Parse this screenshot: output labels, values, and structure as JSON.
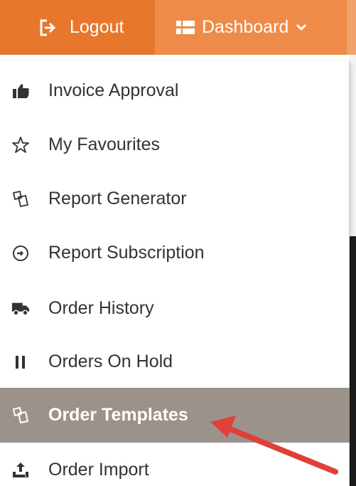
{
  "nav": {
    "logout": {
      "label": "Logout",
      "icon": "logout-icon"
    },
    "dashboard": {
      "label": "Dashboard",
      "icon": "grid-icon",
      "caret_icon": "chevron-down-icon"
    }
  },
  "menu": {
    "items": [
      {
        "label": "Invoice Approval",
        "icon": "thumbs-up-icon"
      },
      {
        "label": "My Favourites",
        "icon": "star-outline-icon"
      },
      {
        "label": "Report Generator",
        "icon": "copy-icon"
      },
      {
        "label": "Report Subscription",
        "icon": "circle-arrow-icon"
      },
      {
        "label": "Order History",
        "icon": "truck-icon"
      },
      {
        "label": "Orders On Hold",
        "icon": "pause-icon"
      },
      {
        "label": "Order Templates",
        "icon": "copy-icon",
        "active": true
      },
      {
        "label": "Order Import",
        "icon": "upload-icon"
      }
    ]
  },
  "colors": {
    "navbar": "#e8772e",
    "navbar_active": "#ee8b48",
    "menu_active_bg": "#9b928c",
    "menu_text": "#333333",
    "annotation_arrow": "#e0403a"
  }
}
